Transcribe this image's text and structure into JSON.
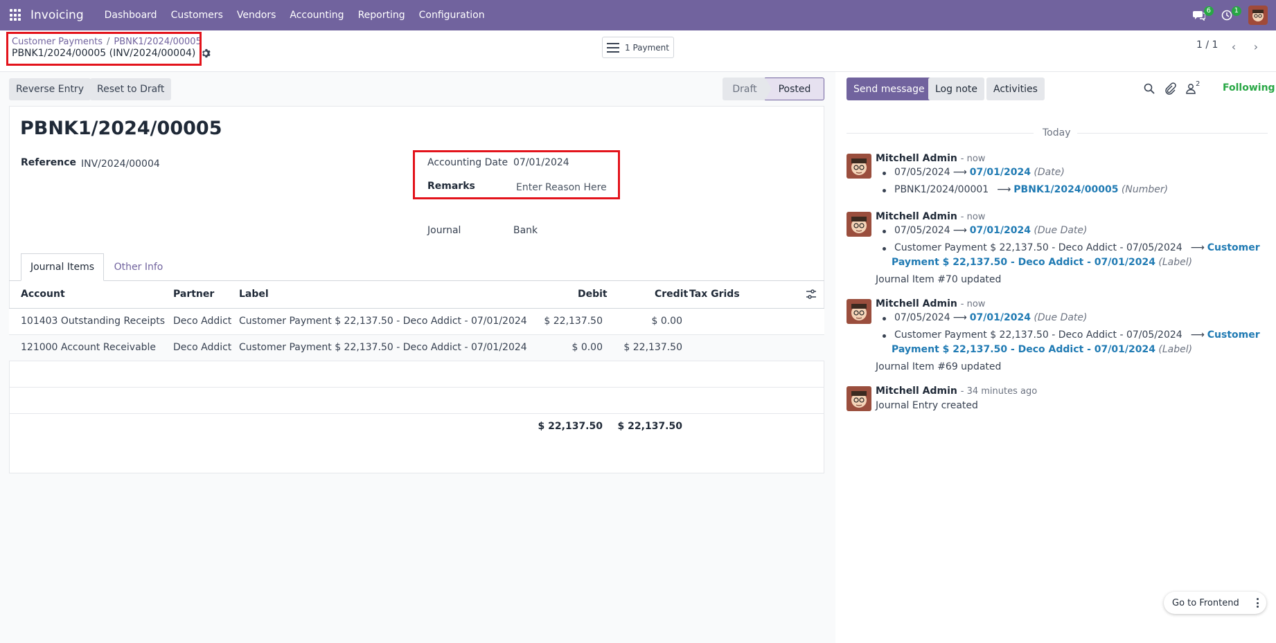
{
  "navbar": {
    "brand": "Invoicing",
    "menu": [
      "Dashboard",
      "Customers",
      "Vendors",
      "Accounting",
      "Reporting",
      "Configuration"
    ],
    "messages_badge": "6",
    "activities_badge": "1"
  },
  "control_panel": {
    "breadcrumb_parent": "Customer Payments",
    "breadcrumb_sep": "/",
    "breadcrumb_current": "PBNK1/2024/00005",
    "record_title": "PBNK1/2024/00005 (INV/2024/00004)",
    "smart_button": "1 Payment",
    "pager": "1 / 1"
  },
  "actions": {
    "reverse_entry": "Reverse Entry",
    "reset_to_draft": "Reset to Draft"
  },
  "status": {
    "draft": "Draft",
    "posted": "Posted"
  },
  "form": {
    "title": "PBNK1/2024/00005",
    "reference_label": "Reference",
    "reference_value": "INV/2024/00004",
    "accounting_date_label": "Accounting Date",
    "accounting_date_value": "07/01/2024",
    "remarks_label": "Remarks",
    "remarks_placeholder": "Enter Reason Here",
    "journal_label": "Journal",
    "journal_value": "Bank"
  },
  "tabs": [
    "Journal Items",
    "Other Info"
  ],
  "table": {
    "headers": [
      "Account",
      "Partner",
      "Label",
      "Debit",
      "Credit",
      "Tax Grids"
    ],
    "rows": [
      {
        "account": "101403 Outstanding Receipts",
        "partner": "Deco Addict",
        "label": "Customer Payment $ 22,137.50 - Deco Addict - 07/01/2024",
        "debit": "$ 22,137.50",
        "credit": "$ 0.00"
      },
      {
        "account": "121000 Account Receivable",
        "partner": "Deco Addict",
        "label": "Customer Payment $ 22,137.50 - Deco Addict - 07/01/2024",
        "debit": "$ 0.00",
        "credit": "$ 22,137.50"
      }
    ],
    "total_debit": "$ 22,137.50",
    "total_credit": "$ 22,137.50"
  },
  "chatter": {
    "send_message": "Send message",
    "log_note": "Log note",
    "activities": "Activities",
    "followers_count": "2",
    "following": "Following",
    "today": "Today",
    "messages": [
      {
        "author": "Mitchell Admin",
        "time": "- now",
        "changes": [
          {
            "old": "07/05/2024",
            "new": "07/01/2024",
            "field": "(Date)"
          },
          {
            "old": "PBNK1/2024/00001",
            "new": "PBNK1/2024/00005",
            "field": "(Number)"
          }
        ]
      },
      {
        "author": "Mitchell Admin",
        "time": "- now",
        "changes": [
          {
            "old": "07/05/2024",
            "new": "07/01/2024",
            "field": "(Due Date)"
          },
          {
            "old": "Customer Payment $ 22,137.50 - Deco Addict - 07/05/2024",
            "new_line1": "Customer",
            "new_line2": "Payment $ 22,137.50 - Deco Addict - 07/01/2024",
            "field": "(Label)"
          }
        ],
        "note": "Journal Item #70 updated"
      },
      {
        "author": "Mitchell Admin",
        "time": "- now",
        "changes": [
          {
            "old": "07/05/2024",
            "new": "07/01/2024",
            "field": "(Due Date)"
          },
          {
            "old": "Customer Payment $ 22,137.50 - Deco Addict - 07/05/2024",
            "new_line1": "Customer",
            "new_line2": "Payment $ 22,137.50 - Deco Addict - 07/01/2024",
            "field": "(Label)"
          }
        ],
        "note": "Journal Item #69 updated"
      },
      {
        "author": "Mitchell Admin",
        "time": "- 34 minutes ago",
        "note": "Journal Entry created"
      }
    ]
  },
  "frontend_button": "Go to Frontend"
}
